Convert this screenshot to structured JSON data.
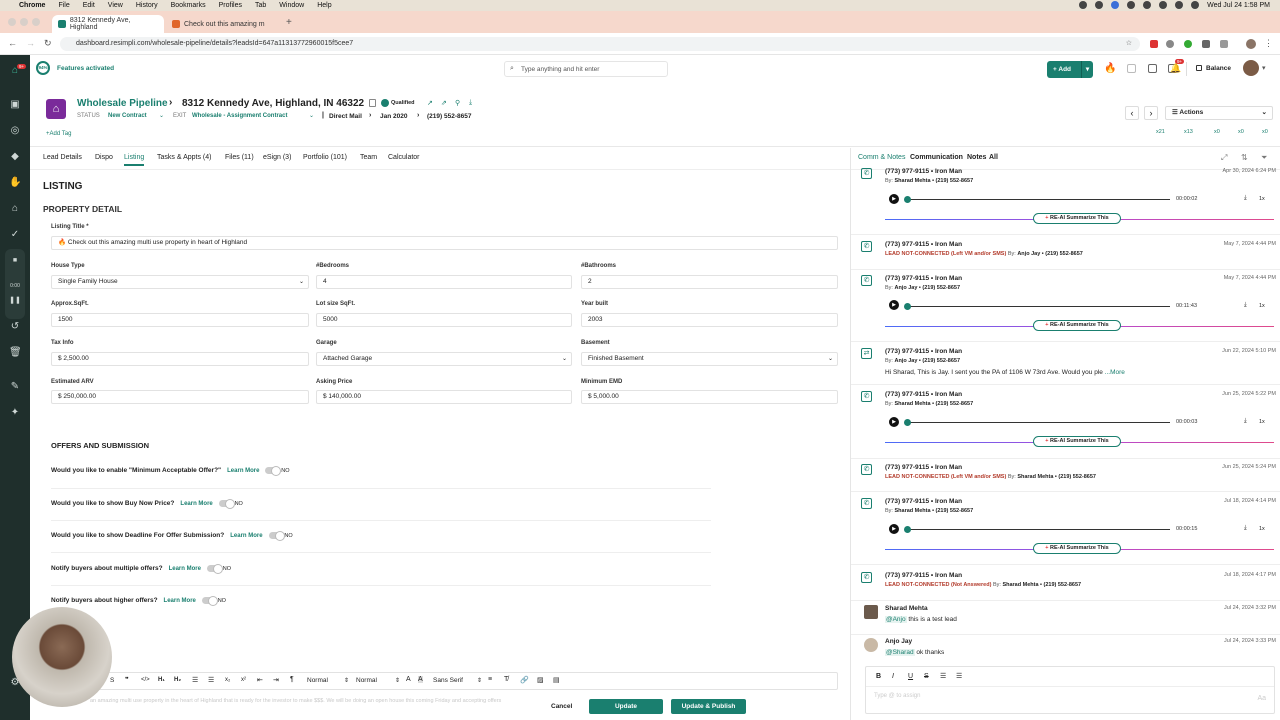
{
  "mac": {
    "app": "Chrome",
    "menus": [
      "File",
      "Edit",
      "View",
      "History",
      "Bookmarks",
      "Profiles",
      "Tab",
      "Window",
      "Help"
    ],
    "clock": "Wed Jul 24  1:58 PM"
  },
  "tabs": [
    {
      "label": "8312 Kennedy Ave, Highland"
    },
    {
      "label": "Check out this amazing m"
    }
  ],
  "url": "dashboard.resimpli.com/wholesale-pipeline/details?leadsId=647a11313772960015f5cee7",
  "app": {
    "features": "Features activated",
    "features_pct": "94%",
    "search_placeholder": "Type anything and hit enter",
    "add": "Add",
    "balance": "Balance",
    "badge": "9+"
  },
  "lead": {
    "pipeline": "Wholesale Pipeline",
    "address": "8312 Kennedy Ave, Highland, IN 46322",
    "qualified": "Qualified",
    "status_label": "STATUS",
    "status": "New Contract",
    "exit_label": "EXIT",
    "exit": "Wholesale - Assignment Contract",
    "source": "Direct Mail",
    "date": "Jan 2020",
    "phone": "(219) 552-8657",
    "add_tag": "+Add Tag",
    "actions": "Actions",
    "counts": [
      "x21",
      "x13",
      "x0",
      "x0",
      "x0"
    ]
  },
  "nav": [
    "Lead Details",
    "Dispo",
    "Listing",
    "Tasks & Appts (4)",
    "Files (11)",
    "eSign (3)",
    "Portfolio (101)",
    "Team",
    "Calculator"
  ],
  "listing": {
    "heading": "LISTING",
    "section": "PROPERTY DETAIL",
    "title_label": "Listing Title *",
    "title_value": "🔥 Check out this amazing multi use property in heart of Highland",
    "fields": [
      {
        "label": "House Type",
        "value": "Single Family House"
      },
      {
        "label": "#Bedrooms",
        "value": "4"
      },
      {
        "label": "#Bathrooms",
        "value": "2"
      },
      {
        "label": "Approx.SqFt.",
        "value": "1500"
      },
      {
        "label": "Lot size SqFt.",
        "value": "5000"
      },
      {
        "label": "Year built",
        "value": "2003"
      },
      {
        "label": "Tax Info",
        "value": "$ 2,500.00"
      },
      {
        "label": "Garage",
        "value": "Attached Garage"
      },
      {
        "label": "Basement",
        "value": "Finished Basement"
      },
      {
        "label": "Estimated ARV",
        "value": "$ 250,000.00"
      },
      {
        "label": "Asking Price",
        "value": "$ 140,000.00"
      },
      {
        "label": "Minimum EMD",
        "value": "$ 5,000.00"
      }
    ],
    "offers_heading": "OFFERS AND SUBMISSION",
    "learn_more": "Learn More",
    "no": "NO",
    "questions": [
      "Would you like to enable \"Minimum Acceptable Offer?\"",
      "Would you like to show Buy Now Price?",
      "Would you like to show Deadline For Offer Submission?",
      "Notify buyers about multiple offers?",
      "Notify buyers about higher offers?"
    ],
    "editor": {
      "font1": "Normal",
      "font2": "Normal",
      "family": "Sans Serif"
    },
    "preview": "an amazing multi use property in the heart of Highland that is ready for the investor to make $$$. We will be doing an open house this coming Friday and accepting offers",
    "cancel": "Cancel",
    "update": "Update",
    "publish": "Update & Publish"
  },
  "right": {
    "tabs": [
      "Comm & Notes",
      "Communication",
      "Notes",
      "All"
    ],
    "summarize": "RE-AI Summarize This",
    "by": "By:",
    "speed": "1x",
    "more": "...More",
    "items": [
      {
        "title": "(773) 977-9115 • Iron Man",
        "by": "Sharad Mehta • (219) 552-8657",
        "date": "Apr 30, 2024 6:24 PM",
        "dur": "00:00:02"
      },
      {
        "title": "(773) 977-9115 • Iron Man",
        "status": "LEAD NOT-CONNECTED (Left VM and/or SMS)",
        "by": "Anjo Jay • (219) 552-8657",
        "date": "May 7, 2024 4:44 PM"
      },
      {
        "title": "(773) 977-9115 • Iron Man",
        "by": "Anjo Jay • (219) 552-8657",
        "date": "May 7, 2024 4:44 PM",
        "dur": "00:11:43"
      },
      {
        "title": "(773) 977-9115 • Iron Man",
        "by": "Anjo Jay • (219) 552-8657",
        "date": "Jun 22, 2024 5:10 PM",
        "msg": "Hi Sharad, This is Jay. I sent you the PA of 1106 W 73rd Ave. Would you ple"
      },
      {
        "title": "(773) 977-9115 • Iron Man",
        "by": "Sharad Mehta • (219) 552-8657",
        "date": "Jun 25, 2024 5:22 PM",
        "dur": "00:00:03"
      },
      {
        "title": "(773) 977-9115 • Iron Man",
        "status": "LEAD NOT-CONNECTED (Left VM and/or SMS)",
        "by": "Sharad Mehta • (219) 552-8657",
        "date": "Jun 25, 2024 5:24 PM"
      },
      {
        "title": "(773) 977-9115 • Iron Man",
        "by": "Sharad Mehta • (219) 552-8657",
        "date": "Jul 18, 2024 4:14 PM",
        "dur": "00:00:15"
      },
      {
        "title": "(773) 977-9115 • Iron Man",
        "status": "LEAD NOT-CONNECTED (Not Answered)",
        "by": "Sharad Mehta • (219) 552-8657",
        "date": "Jul 18, 2024 4:17 PM"
      }
    ],
    "notes": [
      {
        "name": "Sharad Mehta",
        "mention": "@Anjo",
        "text": "this is a test lead",
        "date": "Jul 24, 2024 3:32 PM"
      },
      {
        "name": "Anjo Jay",
        "mention": "@Sharad",
        "text": "ok thanks",
        "date": "Jul 24, 2024 3:33 PM"
      }
    ],
    "note_placeholder": "Type @ to assign"
  },
  "colors": {
    "accent": "#1a7f6f",
    "sidebar": "#1f2f2c",
    "tabbar": "#f6d8cc",
    "red": "#b23a2a"
  }
}
